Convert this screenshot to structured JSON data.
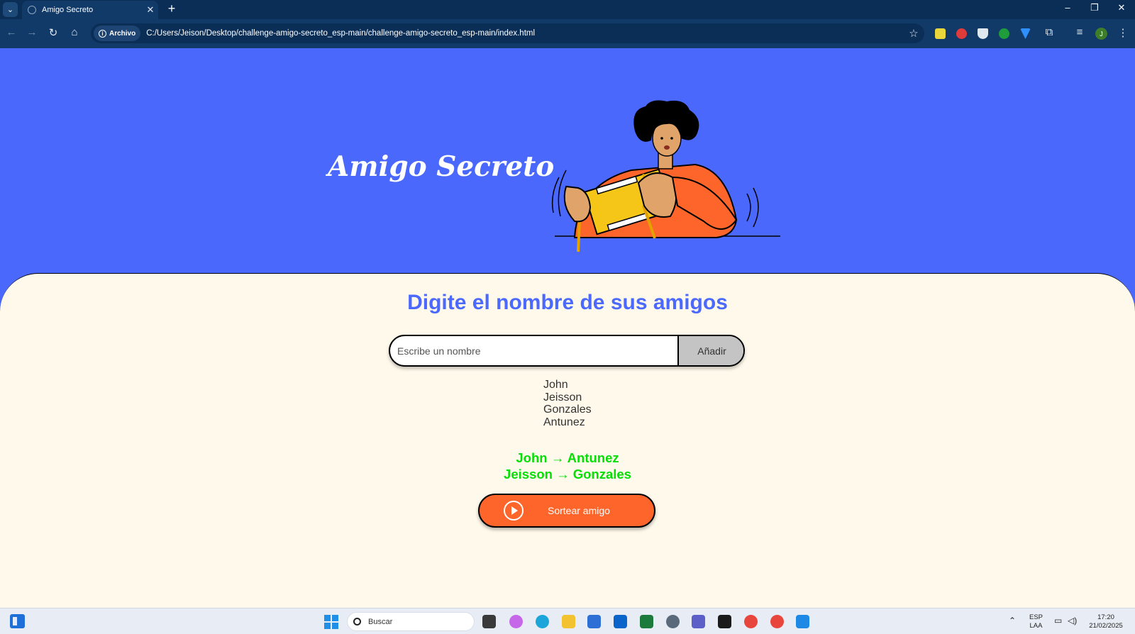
{
  "browser": {
    "tab_title": "Amigo Secreto",
    "tab_close": "✕",
    "new_tab": "+",
    "site_chip": "Archivo",
    "url": "C:/Users/Jeison/Desktop/challenge-amigo-secreto_esp-main/challenge-amigo-secreto_esp-main/index.html",
    "profile_initial": "J",
    "window_controls": {
      "minimize": "–",
      "restore": "❐",
      "close": "✕"
    }
  },
  "page": {
    "hero_title": "Amigo Secreto",
    "section_title": "Digite el nombre de sus amigos",
    "input_placeholder": "Escribe un nombre",
    "add_button": "Añadir",
    "friends": [
      "John",
      "Jeisson",
      "Gonzales",
      "Antunez"
    ],
    "results": [
      "John → Antunez",
      "Jeisson → Gonzales"
    ],
    "draw_button": "Sortear amigo",
    "colors": {
      "header_bg": "#4a69fc",
      "title": "#4b69fd",
      "result": "#05df05",
      "draw_button": "#fe652b",
      "panel_bg": "#fff9eb"
    }
  },
  "taskbar": {
    "search_placeholder": "Buscar",
    "language": "ESP",
    "layout": "LAA",
    "time": "17:20",
    "date": "21/02/2025"
  }
}
